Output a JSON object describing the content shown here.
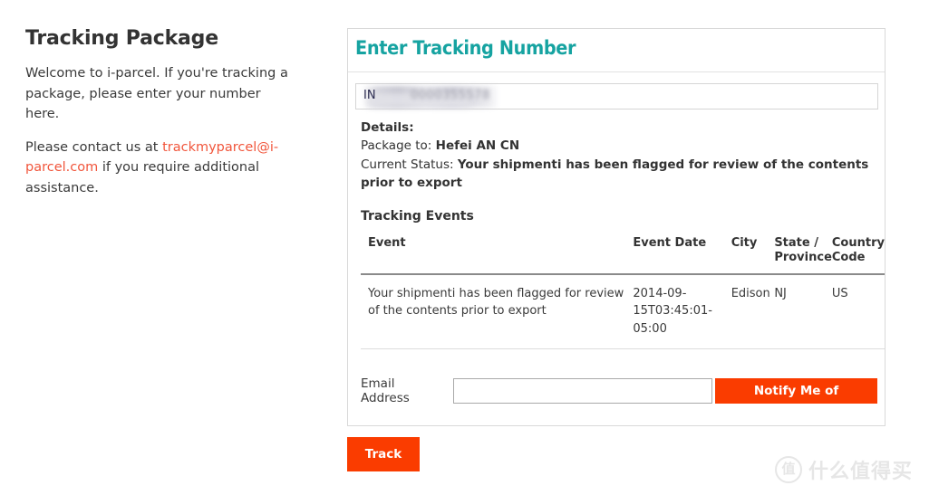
{
  "left": {
    "title": "Tracking Package",
    "para1": "Welcome to i-parcel. If you're tracking a package, please enter your number here.",
    "para2_before": "Please contact us at ",
    "email_link": "trackmyparcel@i-parcel.com",
    "para2_after": " if you require additional assistance."
  },
  "panel": {
    "title": "Enter Tracking Number",
    "tracking_input": {
      "visible_prefix": "IN",
      "redacted_digits": "0000355578",
      "placeholder": "Enter Tracking Number"
    },
    "details": {
      "heading": "Details:",
      "package_to_label": "Package to:",
      "package_to_value": "Hefei AN CN",
      "current_status_label": "Current Status:",
      "current_status_value": "Your shipmenti has been flagged for review of the contents prior to export"
    },
    "tracking_events_title": "Tracking Events",
    "table": {
      "columns": [
        "Event",
        "Event Date",
        "City",
        "State / Province",
        "Country Code"
      ],
      "rows": [
        {
          "event": "Your shipmenti has been flagged for review of the contents prior to export",
          "event_date": "2014-09-15T03:45:01-05:00",
          "city": "Edison",
          "state_province": "NJ",
          "country_code": "US"
        }
      ]
    },
    "email": {
      "label": "Email Address",
      "value": "",
      "placeholder": "",
      "notify_button": "Notify Me of Updates"
    }
  },
  "track_button": "Track",
  "watermark": {
    "mark": "值",
    "text": "什么值得买"
  },
  "colors": {
    "teal_heading": "#16a3a1",
    "orange_button": "#fa3c00",
    "link_orange": "#f1563c",
    "panel_border": "#d9d9d9",
    "table_header_rule": "#8a8a8a"
  }
}
